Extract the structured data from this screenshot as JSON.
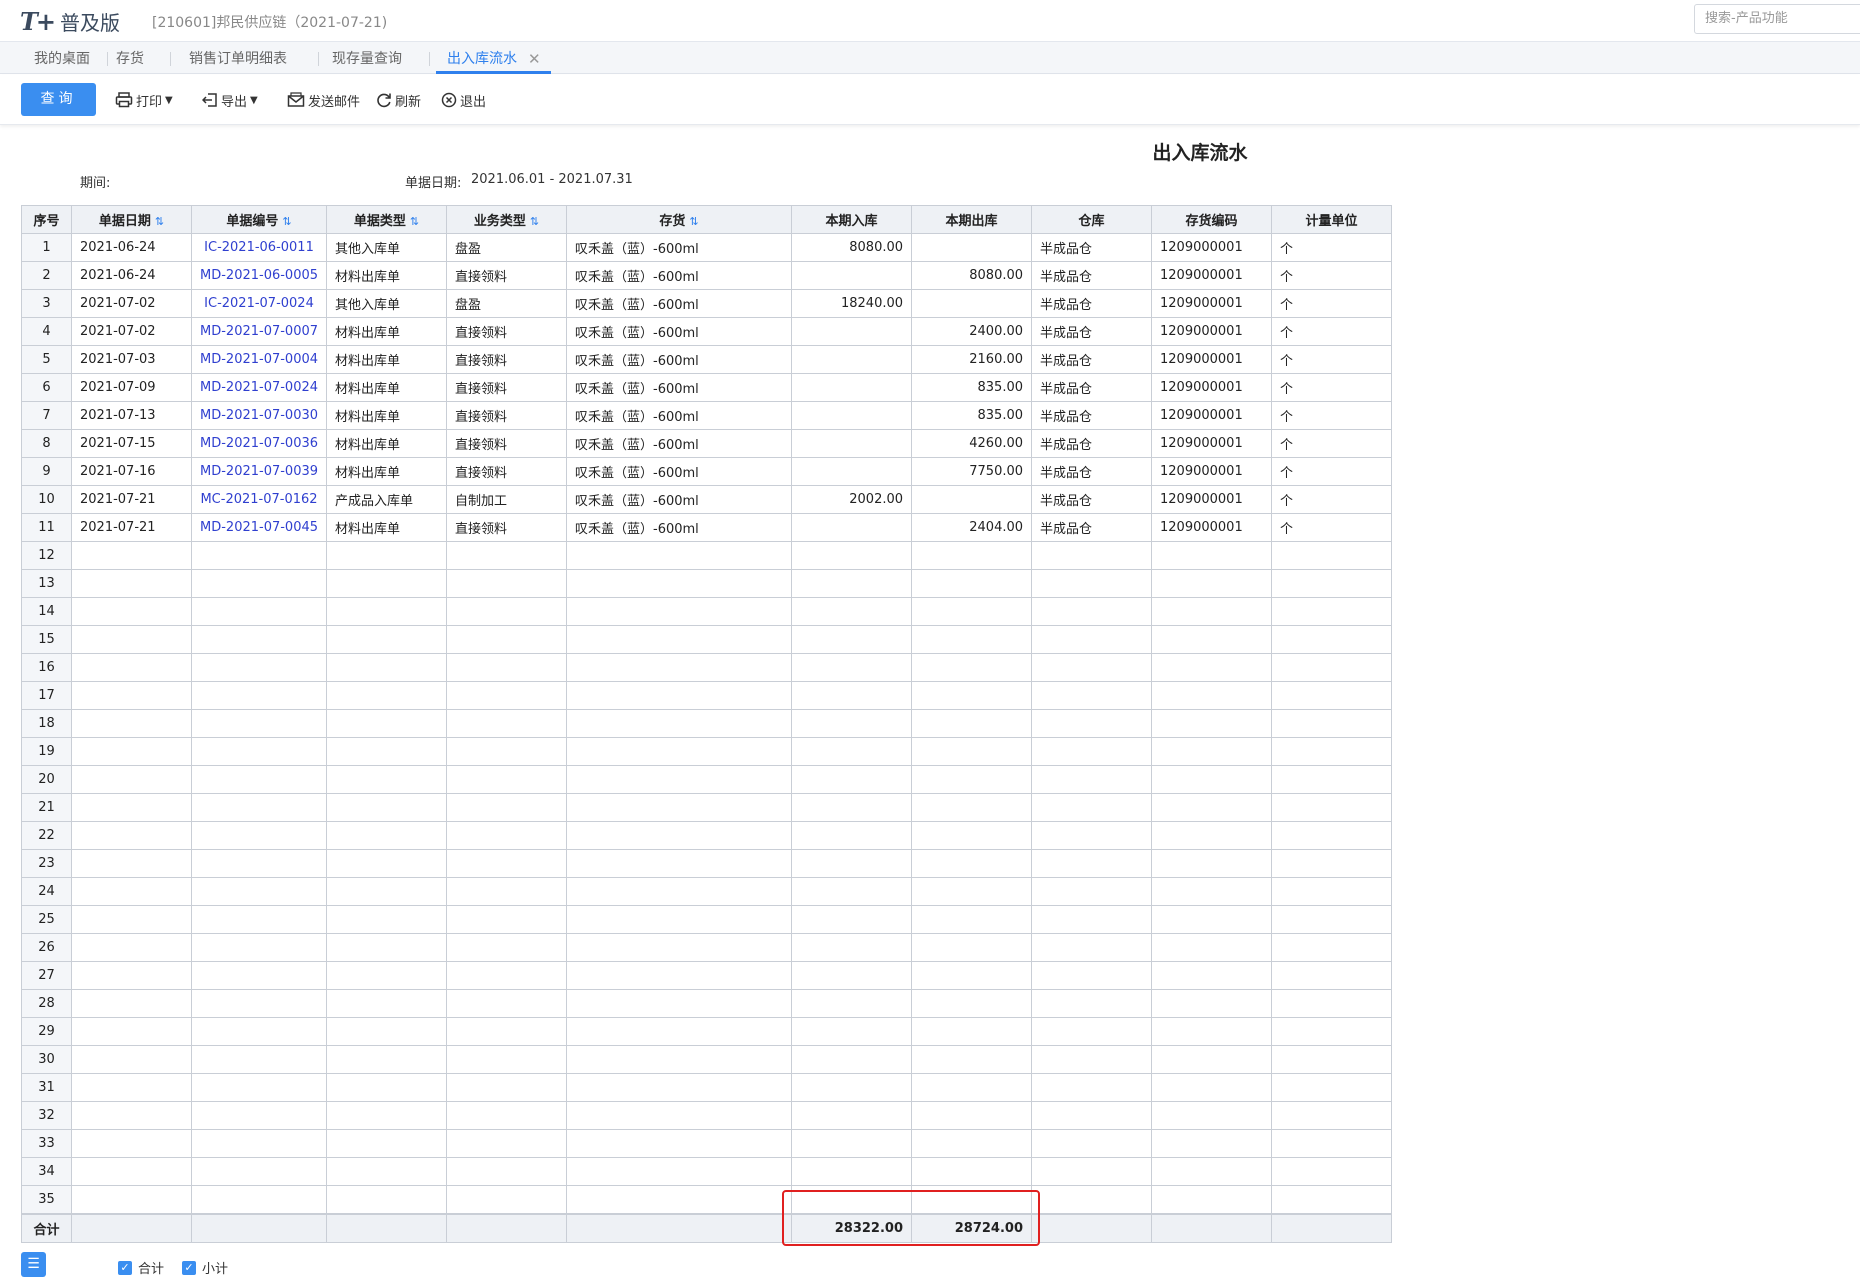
{
  "app": {
    "logo_mark": "T+",
    "logo_text": "普及版",
    "company": "[210601]邦民供应链（2021-07-21)",
    "search_placeholder": "搜索-产品功能"
  },
  "tabs": [
    {
      "label": "我的桌面"
    },
    {
      "label": "存货"
    },
    {
      "label": "销售订单明细表"
    },
    {
      "label": "现存量查询"
    },
    {
      "label": "出入库流水",
      "active": true
    }
  ],
  "toolbar": {
    "query": "查询",
    "print": "打印",
    "export": "导出",
    "email": "发送邮件",
    "refresh": "刷新",
    "exit": "退出"
  },
  "report": {
    "title": "出入库流水",
    "period_label": "期间:",
    "date_label": "单据日期:",
    "date_value": "2021.06.01 - 2021.07.31"
  },
  "columns": [
    "序号",
    "单据日期",
    "单据编号",
    "单据类型",
    "业务类型",
    "存货",
    "本期入库",
    "本期出库",
    "仓库",
    "存货编码",
    "计量单位"
  ],
  "rows": [
    {
      "idx": "1",
      "date": "2021-06-24",
      "code": "IC-2021-06-0011",
      "doc_type": "其他入库单",
      "biz_type": "盘盈",
      "item": "叹禾盖（蓝）-600ml",
      "in": "8080.00",
      "out": "",
      "warehouse": "半成品仓",
      "item_code": "1209000001",
      "unit": "个"
    },
    {
      "idx": "2",
      "date": "2021-06-24",
      "code": "MD-2021-06-0005",
      "doc_type": "材料出库单",
      "biz_type": "直接领料",
      "item": "叹禾盖（蓝）-600ml",
      "in": "",
      "out": "8080.00",
      "warehouse": "半成品仓",
      "item_code": "1209000001",
      "unit": "个"
    },
    {
      "idx": "3",
      "date": "2021-07-02",
      "code": "IC-2021-07-0024",
      "doc_type": "其他入库单",
      "biz_type": "盘盈",
      "item": "叹禾盖（蓝）-600ml",
      "in": "18240.00",
      "out": "",
      "warehouse": "半成品仓",
      "item_code": "1209000001",
      "unit": "个"
    },
    {
      "idx": "4",
      "date": "2021-07-02",
      "code": "MD-2021-07-0007",
      "doc_type": "材料出库单",
      "biz_type": "直接领料",
      "item": "叹禾盖（蓝）-600ml",
      "in": "",
      "out": "2400.00",
      "warehouse": "半成品仓",
      "item_code": "1209000001",
      "unit": "个"
    },
    {
      "idx": "5",
      "date": "2021-07-03",
      "code": "MD-2021-07-0004",
      "doc_type": "材料出库单",
      "biz_type": "直接领料",
      "item": "叹禾盖（蓝）-600ml",
      "in": "",
      "out": "2160.00",
      "warehouse": "半成品仓",
      "item_code": "1209000001",
      "unit": "个"
    },
    {
      "idx": "6",
      "date": "2021-07-09",
      "code": "MD-2021-07-0024",
      "doc_type": "材料出库单",
      "biz_type": "直接领料",
      "item": "叹禾盖（蓝）-600ml",
      "in": "",
      "out": "835.00",
      "warehouse": "半成品仓",
      "item_code": "1209000001",
      "unit": "个"
    },
    {
      "idx": "7",
      "date": "2021-07-13",
      "code": "MD-2021-07-0030",
      "doc_type": "材料出库单",
      "biz_type": "直接领料",
      "item": "叹禾盖（蓝）-600ml",
      "in": "",
      "out": "835.00",
      "warehouse": "半成品仓",
      "item_code": "1209000001",
      "unit": "个"
    },
    {
      "idx": "8",
      "date": "2021-07-15",
      "code": "MD-2021-07-0036",
      "doc_type": "材料出库单",
      "biz_type": "直接领料",
      "item": "叹禾盖（蓝）-600ml",
      "in": "",
      "out": "4260.00",
      "warehouse": "半成品仓",
      "item_code": "1209000001",
      "unit": "个"
    },
    {
      "idx": "9",
      "date": "2021-07-16",
      "code": "MD-2021-07-0039",
      "doc_type": "材料出库单",
      "biz_type": "直接领料",
      "item": "叹禾盖（蓝）-600ml",
      "in": "",
      "out": "7750.00",
      "warehouse": "半成品仓",
      "item_code": "1209000001",
      "unit": "个"
    },
    {
      "idx": "10",
      "date": "2021-07-21",
      "code": "MC-2021-07-0162",
      "doc_type": "产成品入库单",
      "biz_type": "自制加工",
      "item": "叹禾盖（蓝）-600ml",
      "in": "2002.00",
      "out": "",
      "warehouse": "半成品仓",
      "item_code": "1209000001",
      "unit": "个"
    },
    {
      "idx": "11",
      "date": "2021-07-21",
      "code": "MD-2021-07-0045",
      "doc_type": "材料出库单",
      "biz_type": "直接领料",
      "item": "叹禾盖（蓝）-600ml",
      "in": "",
      "out": "2404.00",
      "warehouse": "半成品仓",
      "item_code": "1209000001",
      "unit": "个"
    }
  ],
  "empty_rows": [
    "12",
    "13",
    "14",
    "15",
    "16",
    "17",
    "18",
    "19",
    "20",
    "21",
    "22",
    "23",
    "24",
    "25",
    "26",
    "27",
    "28",
    "29",
    "30",
    "31",
    "32",
    "33",
    "34",
    "35"
  ],
  "total": {
    "label": "合计",
    "in": "28322.00",
    "out": "28724.00"
  },
  "footer": {
    "total_check": "合计",
    "subtotal_check": "小计"
  },
  "colors": {
    "accent": "#3a8ef0",
    "code_link": "#2f3fcf",
    "highlight": "#e02020"
  }
}
